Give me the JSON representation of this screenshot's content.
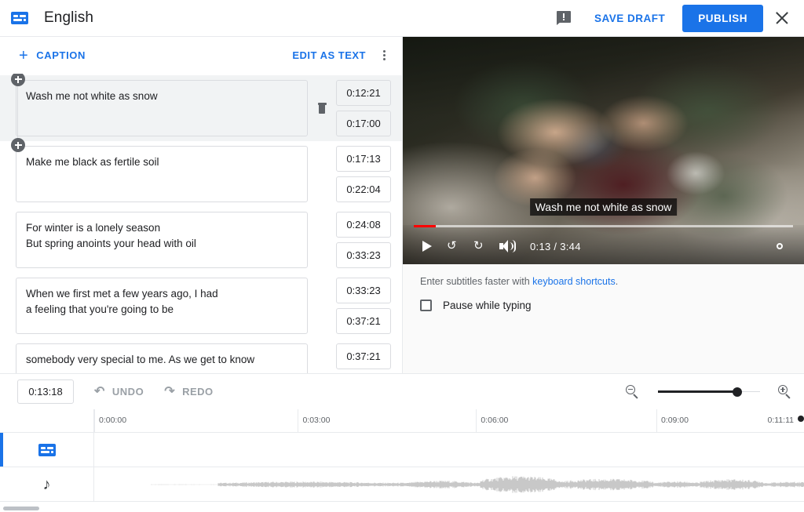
{
  "header": {
    "icon": "subtitles-icon",
    "title": "English",
    "feedback_icon": "feedback-icon",
    "save_draft_label": "SAVE DRAFT",
    "publish_label": "PUBLISH",
    "close_icon": "close-icon",
    "accent_color": "#1a73e8"
  },
  "caption_toolbar": {
    "add_caption_plus": "+",
    "add_caption_label": "CAPTION",
    "edit_as_text_label": "EDIT AS TEXT",
    "overflow_icon": "more-vert-icon"
  },
  "captions": [
    {
      "text": "Wash me not white as snow",
      "start": "0:12:21",
      "end": "0:17:00",
      "active": true
    },
    {
      "text": "Make me black as fertile soil",
      "start": "0:17:13",
      "end": "0:22:04",
      "active": false
    },
    {
      "text": "For winter is a lonely season\nBut spring anoints your head with oil",
      "start": "0:24:08",
      "end": "0:33:23",
      "active": false
    },
    {
      "text": "When we first met a few years ago, I had\na feeling that you're going to be",
      "start": "0:33:23",
      "end": "0:37:21",
      "active": false
    },
    {
      "text": "somebody very special to me. As we get to know",
      "start": "0:37:21",
      "end": "",
      "active": false
    }
  ],
  "player": {
    "subtitle_overlay": "Wash me not white as snow",
    "play_icon": "play-icon",
    "replay_10_icon": "replay-10-icon",
    "forward_10_icon": "forward-10-icon",
    "volume_icon": "volume-icon",
    "time_display": "0:13 / 3:44",
    "current_time": "0:13",
    "duration": "3:44",
    "settings_icon": "gear-icon",
    "progress_percent": 5.8
  },
  "below_player": {
    "hint_prefix": "Enter subtitles faster with ",
    "hint_link": "keyboard shortcuts",
    "hint_suffix": ".",
    "pause_checkbox_label": "Pause while typing",
    "pause_checked": false
  },
  "timeline_toolbar": {
    "current_time": "0:13:18",
    "undo_label": "UNDO",
    "redo_label": "REDO",
    "undo_icon": "undo-icon",
    "redo_icon": "redo-icon",
    "zoom_out_icon": "zoom-out-icon",
    "zoom_in_icon": "zoom-in-icon",
    "zoom_value": 78
  },
  "ruler": {
    "ticks": [
      {
        "label": "0:00:00",
        "pos": 0
      },
      {
        "label": "0:03:00",
        "pos": 28.7
      },
      {
        "label": "0:06:00",
        "pos": 53.8
      },
      {
        "label": "0:09:00",
        "pos": 79.2
      },
      {
        "label": "0:11:11",
        "pos": 97.2
      }
    ]
  },
  "tracks": [
    {
      "name": "caption-track",
      "icon": "subtitles-icon"
    },
    {
      "name": "audio-track",
      "icon": "music-note-icon"
    }
  ]
}
